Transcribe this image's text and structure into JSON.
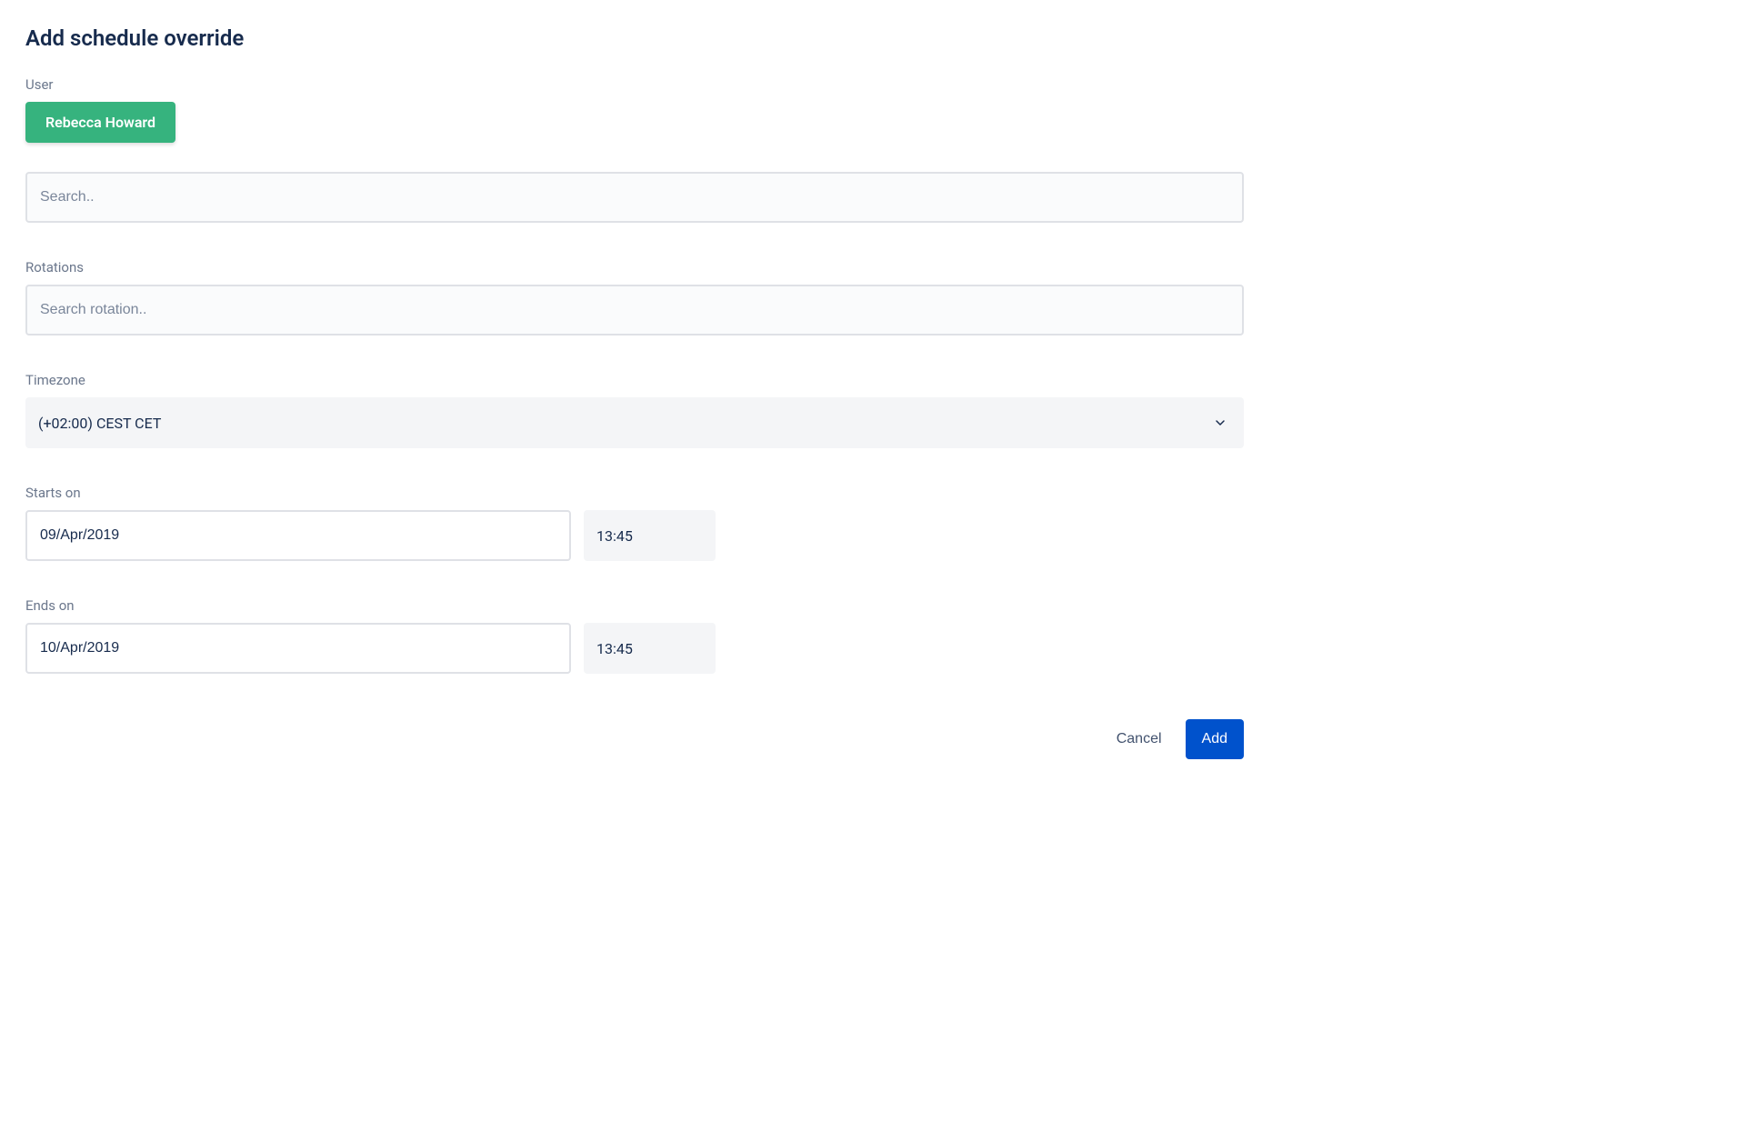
{
  "title": "Add schedule override",
  "user": {
    "label": "User",
    "selected_name": "Rebecca Howard",
    "search_placeholder": "Search.."
  },
  "rotations": {
    "label": "Rotations",
    "search_placeholder": "Search rotation.."
  },
  "timezone": {
    "label": "Timezone",
    "selected": "(+02:00) CEST CET"
  },
  "starts": {
    "label": "Starts on",
    "date": "09/Apr/2019",
    "time": "13:45"
  },
  "ends": {
    "label": "Ends on",
    "date": "10/Apr/2019",
    "time": "13:45"
  },
  "footer": {
    "cancel": "Cancel",
    "submit": "Add"
  }
}
